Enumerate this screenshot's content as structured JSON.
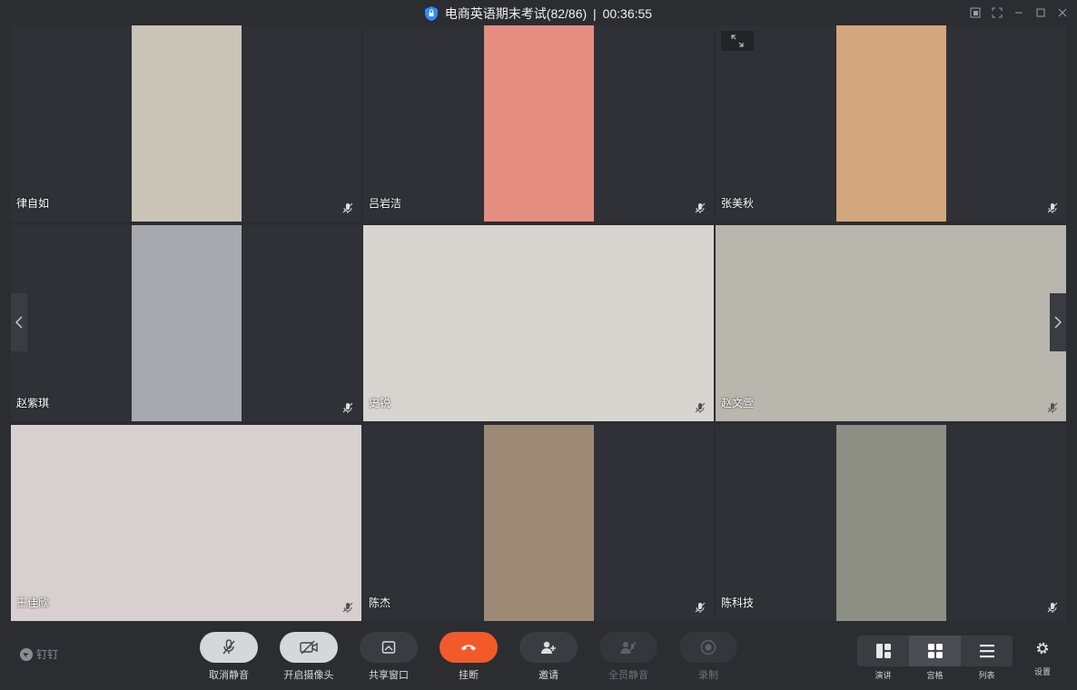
{
  "window": {
    "title": "电商英语期末考试(82/86)",
    "separator": "|",
    "timer": "00:36:55"
  },
  "participants": [
    {
      "name": "律自如",
      "bg": "#c9c3b8"
    },
    {
      "name": "吕岩洁",
      "bg": "#e58d80"
    },
    {
      "name": "张美秋",
      "bg": "#d2a77d"
    },
    {
      "name": "赵紫琪",
      "bg": "#a7a9ae"
    },
    {
      "name": "史锐",
      "bg": "#d7d5cf"
    },
    {
      "name": "赵文萱",
      "bg": "#b9b6ae"
    },
    {
      "name": "王佳欣",
      "bg": "#d8cfd0"
    },
    {
      "name": "陈杰",
      "bg": "#9c8a77"
    },
    {
      "name": "陈科技",
      "bg": "#8e8f84"
    }
  ],
  "toolbar": {
    "brand": "钉钉",
    "unmute": "取消静音",
    "camera": "开启摄像头",
    "share": "共享窗口",
    "hangup": "挂断",
    "invite": "邀请",
    "mute_all": "全员静音",
    "record": "录制",
    "layout_speaker": "演讲",
    "layout_grid": "宫格",
    "layout_list": "列表",
    "settings": "设置"
  },
  "colors": {
    "hangup": "#f25a2a",
    "background": "#2b2d31",
    "title_shield": "#2f8cff"
  }
}
